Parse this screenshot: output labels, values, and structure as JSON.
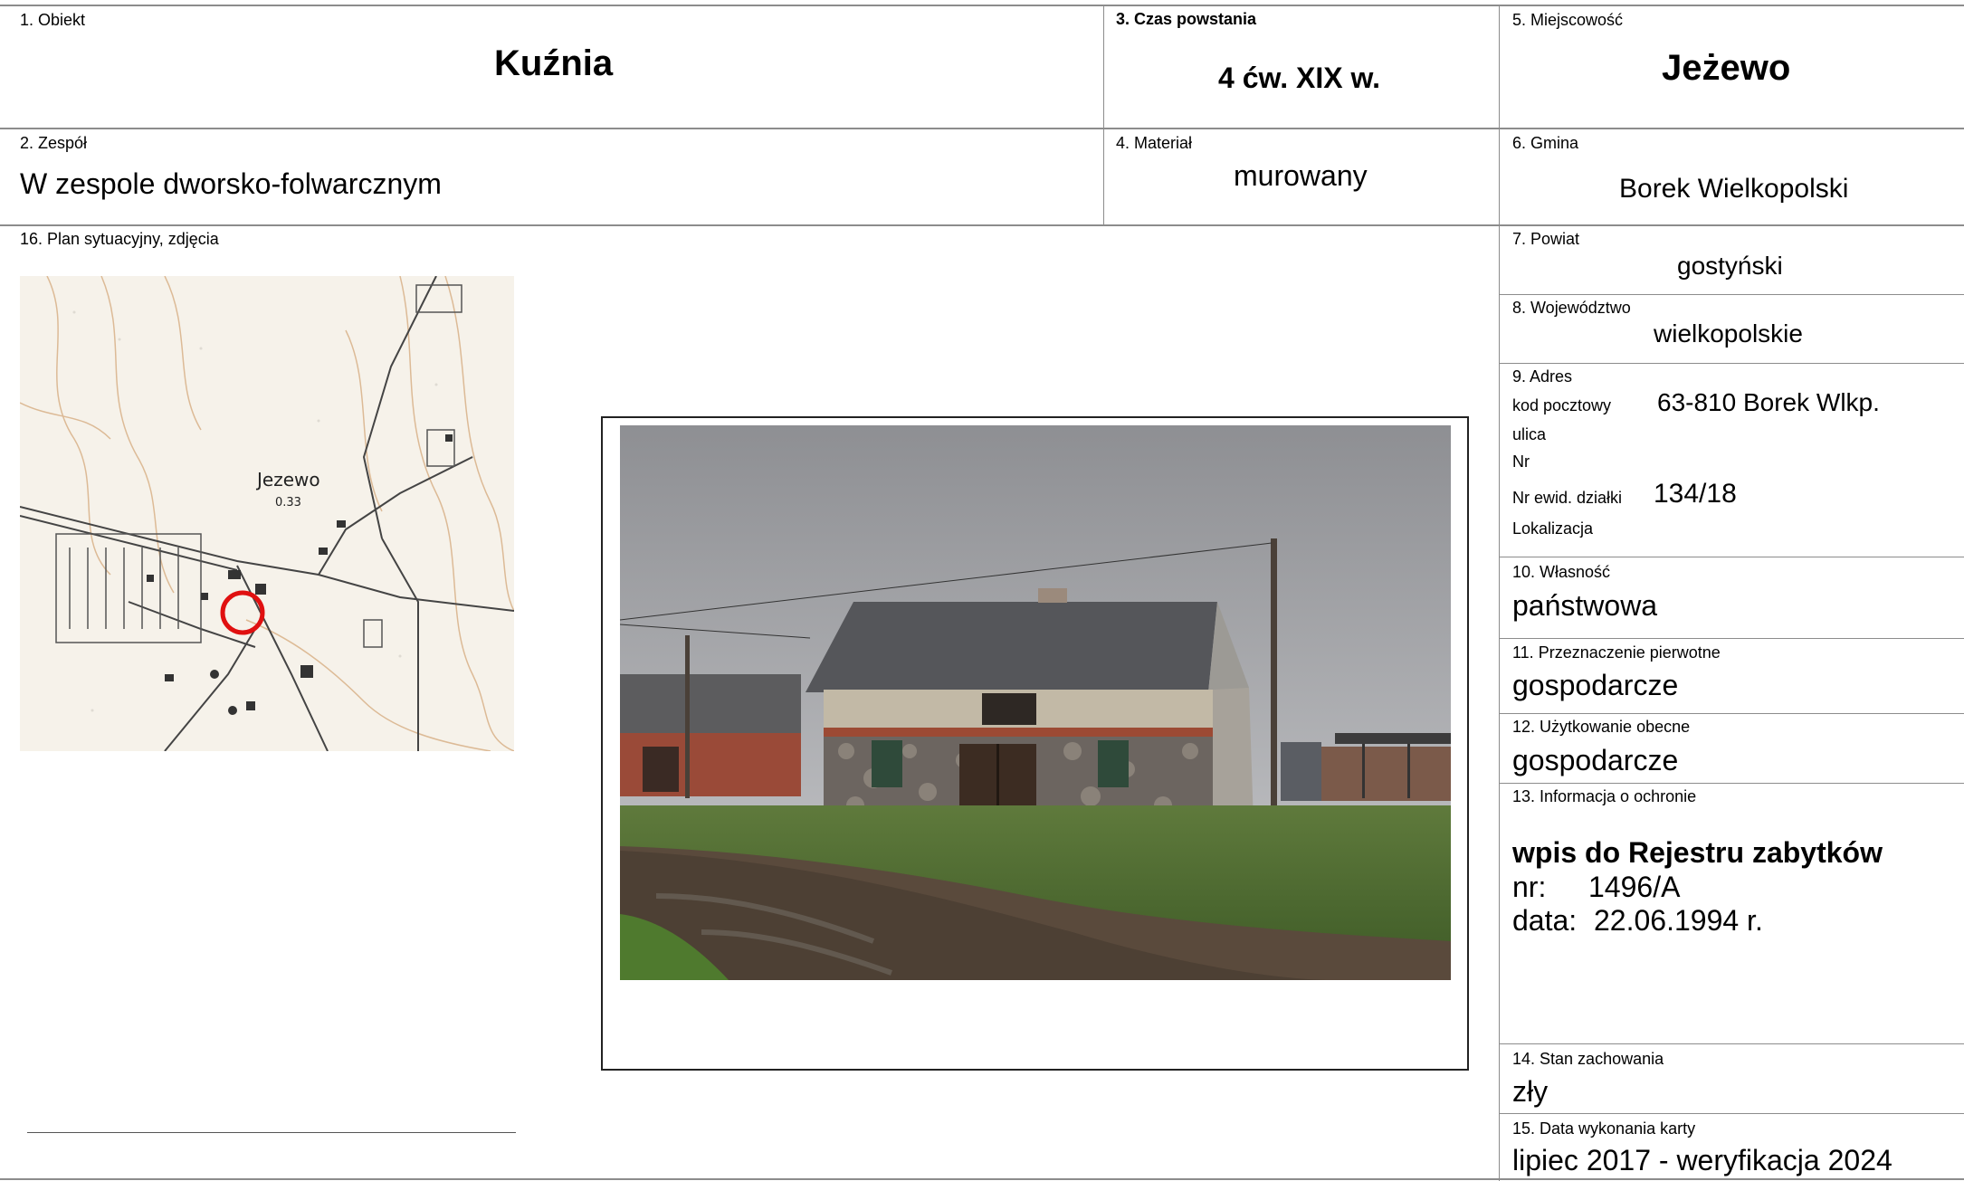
{
  "obiekt": {
    "label": "1. Obiekt",
    "value": "Kuźnia"
  },
  "czas": {
    "label": "3. Czas powstania",
    "value": "4 ćw. XIX w."
  },
  "miejscowosc": {
    "label": "5. Miejscowość",
    "value": "Jeżewo"
  },
  "zespol": {
    "label": "2. Zespół",
    "value": "W zespole dworsko-folwarcznym"
  },
  "material": {
    "label": "4. Materiał",
    "value": "murowany"
  },
  "gmina": {
    "label": "6. Gmina",
    "value": "Borek Wielkopolski"
  },
  "plan": {
    "label": "16. Plan sytuacyjny, zdjęcia",
    "map_place": "Jezewo",
    "map_spot": "0.33"
  },
  "powiat": {
    "label": "7. Powiat",
    "value": "gostyński"
  },
  "wojewodztwo": {
    "label": "8. Województwo",
    "value": "wielkopolskie"
  },
  "adres": {
    "label": "9. Adres",
    "kod_label": "kod pocztowy",
    "kod_value": "63-810 Borek Wlkp.",
    "ulica_label": "ulica",
    "nr_label": "Nr",
    "dzialka_label": "Nr ewid. działki",
    "dzialka_value": "134/18",
    "lokalizacja_label": "Lokalizacja"
  },
  "wlasnosc": {
    "label": "10. Własność",
    "value": "państwowa"
  },
  "przeznaczenie": {
    "label": "11. Przeznaczenie pierwotne",
    "value": "gospodarcze"
  },
  "uzytkowanie": {
    "label": "12. Użytkowanie obecne",
    "value": "gospodarcze"
  },
  "ochrona": {
    "label": "13. Informacja o ochronie",
    "title": "wpis do Rejestru zabytków",
    "nr_label": "nr:",
    "nr_value": "1496/A",
    "data_label": "data:",
    "data_value": "22.06.1994 r."
  },
  "stan": {
    "label": "14. Stan zachowania",
    "value": "zły"
  },
  "data_karty": {
    "label": "15. Data wykonania karty",
    "value": "lipiec 2017 - weryfikacja 2024"
  }
}
